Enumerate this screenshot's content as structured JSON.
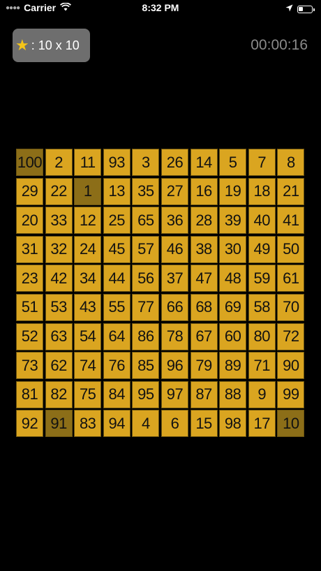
{
  "status_bar": {
    "carrier": "Carrier",
    "time": "8:32 PM",
    "battery_percent": 35
  },
  "header": {
    "level_label": ": 10 x 10",
    "timer": "00:00:16"
  },
  "colors": {
    "tile": "#daa520",
    "tile_found": "#8c6e18",
    "background": "#000000"
  },
  "grid": {
    "rows": 10,
    "cols": 10,
    "cells": [
      {
        "value": "100",
        "found": true
      },
      {
        "value": "2",
        "found": false
      },
      {
        "value": "11",
        "found": false
      },
      {
        "value": "93",
        "found": false
      },
      {
        "value": "3",
        "found": false
      },
      {
        "value": "26",
        "found": false
      },
      {
        "value": "14",
        "found": false
      },
      {
        "value": "5",
        "found": false
      },
      {
        "value": "7",
        "found": false
      },
      {
        "value": "8",
        "found": false
      },
      {
        "value": "29",
        "found": false
      },
      {
        "value": "22",
        "found": false
      },
      {
        "value": "1",
        "found": true
      },
      {
        "value": "13",
        "found": false
      },
      {
        "value": "35",
        "found": false
      },
      {
        "value": "27",
        "found": false
      },
      {
        "value": "16",
        "found": false
      },
      {
        "value": "19",
        "found": false
      },
      {
        "value": "18",
        "found": false
      },
      {
        "value": "21",
        "found": false
      },
      {
        "value": "20",
        "found": false
      },
      {
        "value": "33",
        "found": false
      },
      {
        "value": "12",
        "found": false
      },
      {
        "value": "25",
        "found": false
      },
      {
        "value": "65",
        "found": false
      },
      {
        "value": "36",
        "found": false
      },
      {
        "value": "28",
        "found": false
      },
      {
        "value": "39",
        "found": false
      },
      {
        "value": "40",
        "found": false
      },
      {
        "value": "41",
        "found": false
      },
      {
        "value": "31",
        "found": false
      },
      {
        "value": "32",
        "found": false
      },
      {
        "value": "24",
        "found": false
      },
      {
        "value": "45",
        "found": false
      },
      {
        "value": "57",
        "found": false
      },
      {
        "value": "46",
        "found": false
      },
      {
        "value": "38",
        "found": false
      },
      {
        "value": "30",
        "found": false
      },
      {
        "value": "49",
        "found": false
      },
      {
        "value": "50",
        "found": false
      },
      {
        "value": "23",
        "found": false
      },
      {
        "value": "42",
        "found": false
      },
      {
        "value": "34",
        "found": false
      },
      {
        "value": "44",
        "found": false
      },
      {
        "value": "56",
        "found": false
      },
      {
        "value": "37",
        "found": false
      },
      {
        "value": "47",
        "found": false
      },
      {
        "value": "48",
        "found": false
      },
      {
        "value": "59",
        "found": false
      },
      {
        "value": "61",
        "found": false
      },
      {
        "value": "51",
        "found": false
      },
      {
        "value": "53",
        "found": false
      },
      {
        "value": "43",
        "found": false
      },
      {
        "value": "55",
        "found": false
      },
      {
        "value": "77",
        "found": false
      },
      {
        "value": "66",
        "found": false
      },
      {
        "value": "68",
        "found": false
      },
      {
        "value": "69",
        "found": false
      },
      {
        "value": "58",
        "found": false
      },
      {
        "value": "70",
        "found": false
      },
      {
        "value": "52",
        "found": false
      },
      {
        "value": "63",
        "found": false
      },
      {
        "value": "54",
        "found": false
      },
      {
        "value": "64",
        "found": false
      },
      {
        "value": "86",
        "found": false
      },
      {
        "value": "78",
        "found": false
      },
      {
        "value": "67",
        "found": false
      },
      {
        "value": "60",
        "found": false
      },
      {
        "value": "80",
        "found": false
      },
      {
        "value": "72",
        "found": false
      },
      {
        "value": "73",
        "found": false
      },
      {
        "value": "62",
        "found": false
      },
      {
        "value": "74",
        "found": false
      },
      {
        "value": "76",
        "found": false
      },
      {
        "value": "85",
        "found": false
      },
      {
        "value": "96",
        "found": false
      },
      {
        "value": "79",
        "found": false
      },
      {
        "value": "89",
        "found": false
      },
      {
        "value": "71",
        "found": false
      },
      {
        "value": "90",
        "found": false
      },
      {
        "value": "81",
        "found": false
      },
      {
        "value": "82",
        "found": false
      },
      {
        "value": "75",
        "found": false
      },
      {
        "value": "84",
        "found": false
      },
      {
        "value": "95",
        "found": false
      },
      {
        "value": "97",
        "found": false
      },
      {
        "value": "87",
        "found": false
      },
      {
        "value": "88",
        "found": false
      },
      {
        "value": "9",
        "found": false
      },
      {
        "value": "99",
        "found": false
      },
      {
        "value": "92",
        "found": false
      },
      {
        "value": "91",
        "found": true
      },
      {
        "value": "83",
        "found": false
      },
      {
        "value": "94",
        "found": false
      },
      {
        "value": "4",
        "found": false
      },
      {
        "value": "6",
        "found": false
      },
      {
        "value": "15",
        "found": false
      },
      {
        "value": "98",
        "found": false
      },
      {
        "value": "17",
        "found": false
      },
      {
        "value": "10",
        "found": true
      }
    ]
  }
}
